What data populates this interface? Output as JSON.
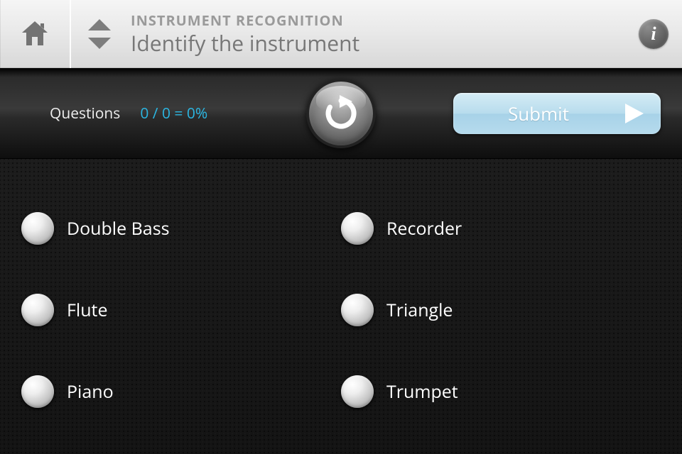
{
  "header": {
    "subtitle": "INSTRUMENT RECOGNITION",
    "title": "Identify the instrument"
  },
  "status": {
    "questions_label": "Questions",
    "questions_value": "0 / 0 = 0%",
    "submit_label": "Submit"
  },
  "options": [
    {
      "label": "Double Bass"
    },
    {
      "label": "Recorder"
    },
    {
      "label": "Flute"
    },
    {
      "label": "Triangle"
    },
    {
      "label": "Piano"
    },
    {
      "label": "Trumpet"
    }
  ],
  "colors": {
    "accent": "#2bb7e3",
    "submit_bg": "#b8dced"
  }
}
